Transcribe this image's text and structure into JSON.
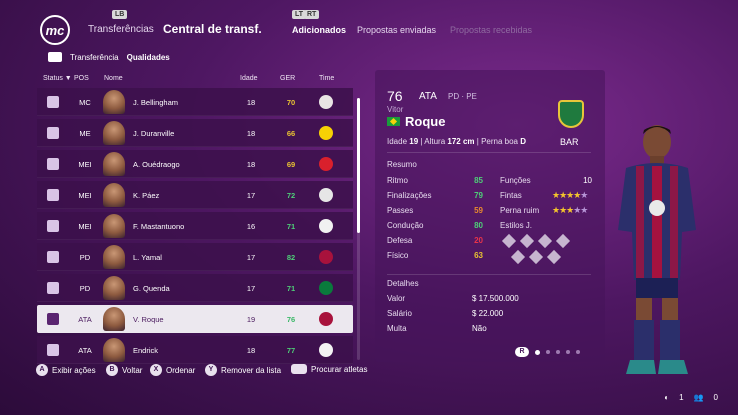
{
  "topnav": {
    "logo": "mc",
    "transfers": "Transferências",
    "hub": "Central de transf.",
    "added": "Adicionados",
    "sent": "Propostas enviadas",
    "received": "Propostas recebidas"
  },
  "filters": {
    "transfer": "Transferência",
    "qualities": "Qualidades"
  },
  "list_headers": {
    "status": "Status ▼",
    "pos": "POS",
    "name": "Nome",
    "age": "Idade",
    "ger": "GER",
    "team": "Time"
  },
  "players": [
    {
      "pos": "MC",
      "name": "J. Bellingham",
      "age": "18",
      "ger": "70",
      "ger_color": "#e8c332",
      "crest_color": "#e9e4e4"
    },
    {
      "pos": "ME",
      "name": "J. Duranville",
      "age": "18",
      "ger": "66",
      "ger_color": "#e8c332",
      "crest_color": "#f6d104"
    },
    {
      "pos": "MEI",
      "name": "A. Ouédraogo",
      "age": "18",
      "ger": "69",
      "ger_color": "#e8c332",
      "crest_color": "#d9202c"
    },
    {
      "pos": "MEI",
      "name": "K. Páez",
      "age": "17",
      "ger": "72",
      "ger_color": "#4ecf78",
      "crest_color": "#e6e6e6"
    },
    {
      "pos": "MEI",
      "name": "F. Mastantuono",
      "age": "16",
      "ger": "71",
      "ger_color": "#4ecf78",
      "crest_color": "#f1f1f1"
    },
    {
      "pos": "PD",
      "name": "L. Yamal",
      "age": "17",
      "ger": "82",
      "ger_color": "#4ecf78",
      "crest_color": "#a8123c"
    },
    {
      "pos": "PD",
      "name": "G. Quenda",
      "age": "17",
      "ger": "71",
      "ger_color": "#4ecf78",
      "crest_color": "#0a7a3c"
    },
    {
      "pos": "ATA",
      "name": "V. Roque",
      "age": "19",
      "ger": "76",
      "ger_color": "#3ab867",
      "crest_color": "#a8123c"
    },
    {
      "pos": "ATA",
      "name": "Endrick",
      "age": "18",
      "ger": "77",
      "ger_color": "#4ecf78",
      "crest_color": "#f3f3f3"
    }
  ],
  "detail": {
    "rating": "76",
    "position": "ATA",
    "alt_positions": "PD · PE",
    "first_name": "Vitor",
    "last_name": "Roque",
    "club_code": "BAR",
    "age_label": "Idade",
    "age": "19",
    "height_label": "Altura",
    "height": "172 cm",
    "foot_label": "Perna boa",
    "foot": "D",
    "summary_title": "Resumo",
    "stats": [
      {
        "label": "Ritmo",
        "value": "85",
        "color": "#4ecf78"
      },
      {
        "label": "Finalizações",
        "value": "79",
        "color": "#4ecf78"
      },
      {
        "label": "Passes",
        "value": "59",
        "color": "#e88a2e"
      },
      {
        "label": "Condução",
        "value": "80",
        "color": "#4ecf78"
      },
      {
        "label": "Defesa",
        "value": "20",
        "color": "#e8344a"
      },
      {
        "label": "Físico",
        "value": "63",
        "color": "#e8c332"
      }
    ],
    "funcoes_label": "Funções",
    "funcoes": "10",
    "fintas_label": "Fintas",
    "fintas_stars": "★★★★★",
    "perna_ruim_label": "Perna ruim",
    "perna_ruim_stars": "★★★★★",
    "estilos_label": "Estilos J.",
    "details_title": "Detalhes",
    "value_label": "Valor",
    "value": "$ 17.500.000",
    "salary_label": "Salário",
    "salary": "$ 22.000",
    "fine_label": "Multa",
    "fine": "Não",
    "pager_button": "R"
  },
  "hints": {
    "a": "A",
    "a_label": "Exibir ações",
    "b": "B",
    "b_label": "Voltar",
    "x": "X",
    "x_label": "Ordenar",
    "y": "Y",
    "y_label": "Remover da lista",
    "search_label": "Procurar atletas"
  },
  "corner": {
    "count1": "1",
    "count2": "0"
  }
}
